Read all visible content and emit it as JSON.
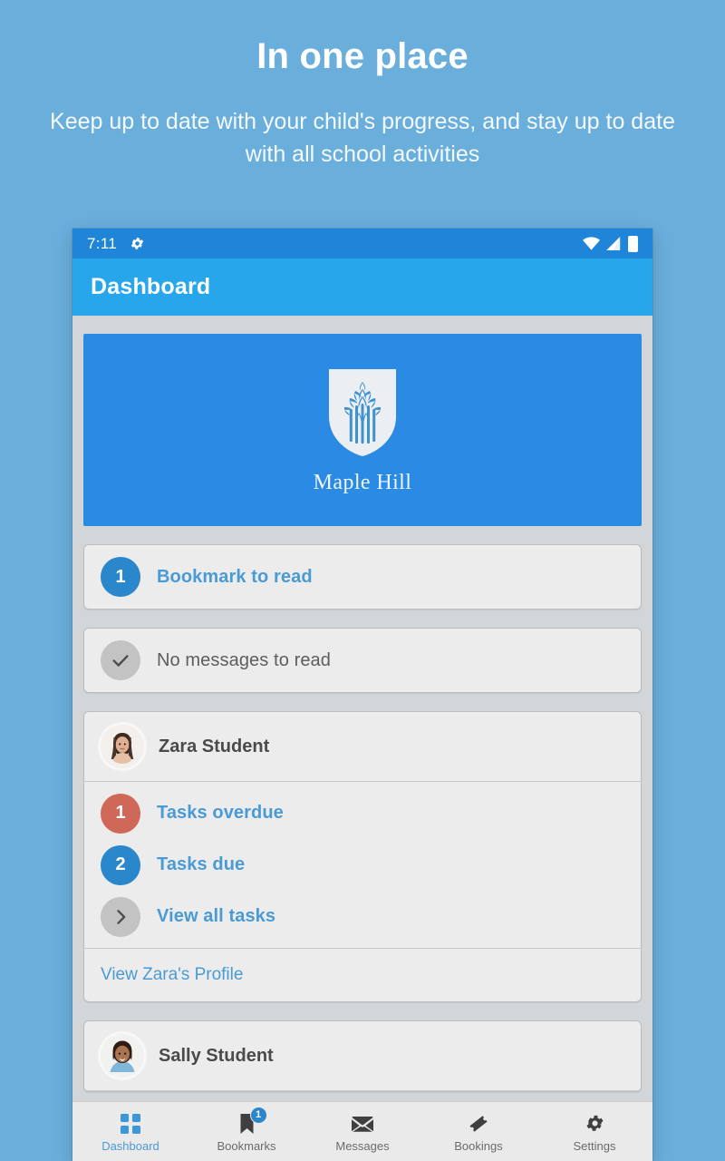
{
  "promo": {
    "title": "In one place",
    "subtitle": "Keep up to date with your child's progress, and stay up to date with all school activities"
  },
  "statusbar": {
    "time": "7:11",
    "gear_icon": "gear-icon",
    "wifi_icon": "wifi-icon",
    "signal_icon": "signal-icon",
    "battery_icon": "battery-icon"
  },
  "appbar": {
    "title": "Dashboard"
  },
  "school": {
    "name": "Maple Hill",
    "logo_icon": "shield-tree-logo-icon",
    "banner_color": "#2b8ae4"
  },
  "summary_cards": [
    {
      "count": "1",
      "label": "Bookmark to read",
      "badge_color": "#2b87cc",
      "badge_style": "blue",
      "label_style": "link"
    },
    {
      "count": "check-icon",
      "label": "No messages to read",
      "badge_color": "#c3c3c3",
      "badge_style": "grey",
      "label_style": "muted"
    }
  ],
  "students": [
    {
      "name": "Zara Student",
      "avatar_icon": "avatar-zara",
      "tasks": [
        {
          "count": "1",
          "label": "Tasks overdue",
          "badge_color": "#d0685a",
          "badge_style": "red"
        },
        {
          "count": "2",
          "label": "Tasks due",
          "badge_color": "#2b87cc",
          "badge_style": "blue"
        },
        {
          "count": "chevron-right-icon",
          "label": "View all tasks",
          "badge_color": "#c3c3c3",
          "badge_style": "grey"
        }
      ],
      "profile_link": "View Zara's Profile"
    },
    {
      "name": "Sally Student",
      "avatar_icon": "avatar-sally",
      "tasks": [],
      "profile_link": ""
    }
  ],
  "bottom_nav": [
    {
      "label": "Dashboard",
      "icon": "grid-icon",
      "active": true,
      "badge": ""
    },
    {
      "label": "Bookmarks",
      "icon": "bookmark-icon",
      "active": false,
      "badge": "1"
    },
    {
      "label": "Messages",
      "icon": "envelope-icon",
      "active": false,
      "badge": ""
    },
    {
      "label": "Bookings",
      "icon": "ticket-icon",
      "active": false,
      "badge": ""
    },
    {
      "label": "Settings",
      "icon": "gear-icon",
      "active": false,
      "badge": ""
    }
  ],
  "colors": {
    "page_background": "#6aaedc",
    "appbar": "#27a6ec",
    "statusbar": "#1e85d8",
    "accent_link": "#4a9ad4",
    "overdue": "#d0685a",
    "screen_background": "#d2d6d9",
    "card_background": "#ececec"
  }
}
